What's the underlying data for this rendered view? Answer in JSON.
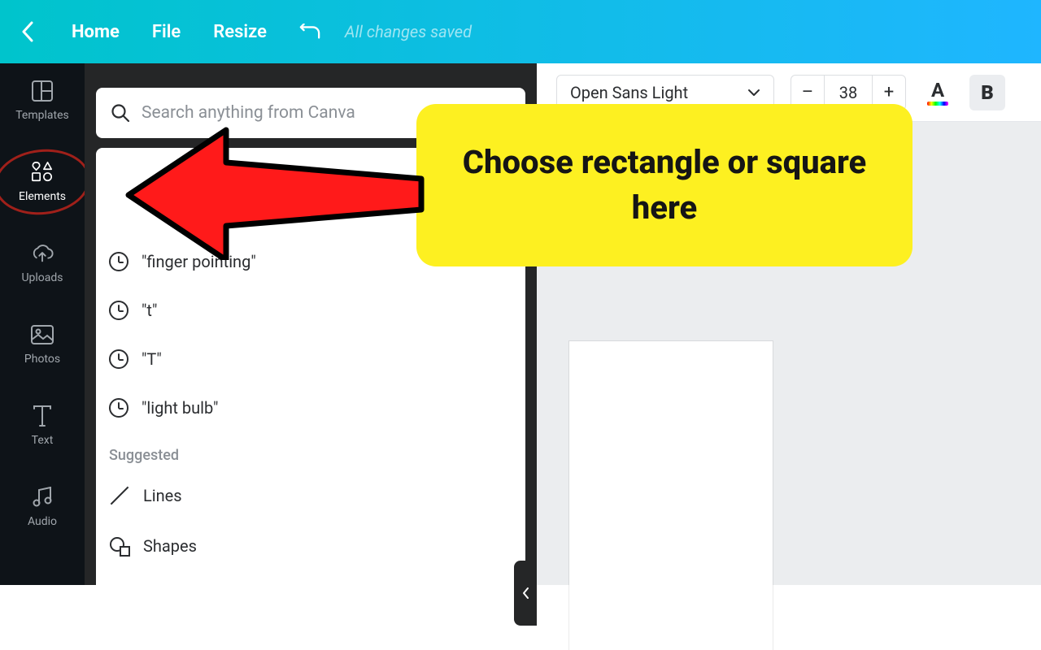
{
  "topbar": {
    "home": "Home",
    "file": "File",
    "resize": "Resize",
    "saved": "All changes saved"
  },
  "rail": {
    "templates": "Templates",
    "elements": "Elements",
    "uploads": "Uploads",
    "photos": "Photos",
    "text": "Text",
    "audio": "Audio"
  },
  "search": {
    "placeholder": "Search anything from Canva"
  },
  "recent": [
    "\"finger pointing\"",
    "\"t\"",
    "\"T\"",
    "\"light bulb\""
  ],
  "suggested": {
    "heading": "Suggested",
    "lines": "Lines",
    "shapes": "Shapes"
  },
  "text_toolbar": {
    "font": "Open Sans Light",
    "size": "38",
    "bold": "B",
    "color_letter": "A",
    "minus": "–",
    "plus": "+"
  },
  "annotation": {
    "callout": "Choose rectangle or square here"
  }
}
